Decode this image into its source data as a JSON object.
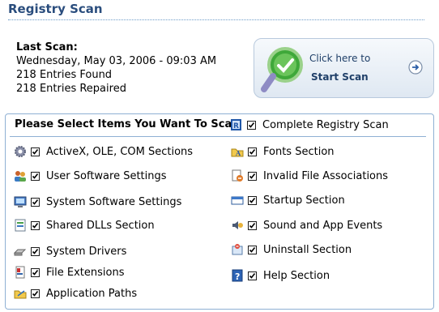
{
  "title": "Registry Scan",
  "last_scan": {
    "header": "Last Scan:",
    "date": "Wednesday, May 03, 2006 -  09:03 AM",
    "found": "218 Entries Found",
    "repaired": "218 Entries Repaired"
  },
  "start_scan": {
    "line1": "Click here to",
    "line2": "Start Scan"
  },
  "panel": {
    "heading": "Please Select Items You Want To Scan",
    "complete": {
      "label": "Complete Registry Scan",
      "checked": true,
      "icon": "registry-icon"
    },
    "left_items": [
      {
        "label": "ActiveX, OLE, COM Sections",
        "checked": true,
        "icon": "gear-icon"
      },
      {
        "label": "User Software Settings",
        "checked": true,
        "icon": "users-icon"
      },
      {
        "label": "System Software Settings",
        "checked": true,
        "icon": "computer-icon"
      },
      {
        "label": "Shared DLLs Section",
        "checked": true,
        "icon": "dll-icon"
      },
      {
        "label": "System Drivers",
        "checked": true,
        "icon": "drive-icon"
      },
      {
        "label": "File Extensions",
        "checked": true,
        "icon": "file-extension-icon"
      },
      {
        "label": "Application Paths",
        "checked": true,
        "icon": "folder-path-icon"
      }
    ],
    "right_items": [
      {
        "label": "Fonts Section",
        "checked": true,
        "icon": "fonts-folder-icon"
      },
      {
        "label": "Invalid File Associations",
        "checked": true,
        "icon": "file-association-icon"
      },
      {
        "label": "Startup Section",
        "checked": true,
        "icon": "startup-icon"
      },
      {
        "label": "Sound and App Events",
        "checked": true,
        "icon": "sound-icon"
      },
      {
        "label": "Uninstall Section",
        "checked": true,
        "icon": "uninstall-icon"
      },
      {
        "label": "Help Section",
        "checked": true,
        "icon": "help-icon"
      }
    ]
  }
}
